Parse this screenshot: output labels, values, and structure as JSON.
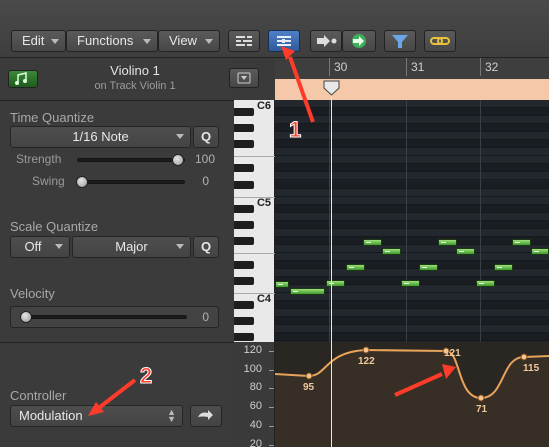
{
  "menus": [
    {
      "label": "Edit"
    },
    {
      "label": "Functions"
    },
    {
      "label": "View"
    }
  ],
  "region": {
    "name": "Violino 1",
    "track_line": "on Track Violin 1"
  },
  "time_quantize": {
    "section_label": "Time Quantize",
    "value": "1/16 Note",
    "q_label": "Q",
    "strength_label": "Strength",
    "strength_value": "100",
    "strength_fraction": 1.0,
    "swing_label": "Swing",
    "swing_value": "0",
    "swing_fraction": 0.0
  },
  "scale_quantize": {
    "section_label": "Scale Quantize",
    "root": "Off",
    "scale": "Major",
    "q_label": "Q"
  },
  "velocity": {
    "section_label": "Velocity",
    "value": "0",
    "fraction": 0.0
  },
  "controller": {
    "section_label": "Controller",
    "value": "Modulation"
  },
  "ruler": {
    "bars": [
      "30",
      "31",
      "32"
    ]
  },
  "piano": {
    "labels": [
      "C6",
      "C5",
      "C4"
    ]
  },
  "controller_scale": [
    "120",
    "100",
    "80",
    "60",
    "40",
    "20"
  ],
  "automation_points": [
    {
      "label": "95"
    },
    {
      "label": "122"
    },
    {
      "label": "121"
    },
    {
      "label": "71"
    },
    {
      "label": "115"
    }
  ],
  "annotations": [
    "1",
    "2"
  ],
  "colors": {
    "accent_blue": "#3f6db3",
    "note_green": "#5cbf3a",
    "automation_line": "#e8a45a",
    "loop_bar": "#f4c8a8",
    "annotation_red": "#ff3b2a"
  },
  "icons": [
    "midi-region-icon",
    "inspector-toggle-icon",
    "catch-playhead-icon",
    "midi-in-icon",
    "midi-out-icon",
    "filter-icon",
    "link-icon",
    "transfer-arrow-icon"
  ]
}
